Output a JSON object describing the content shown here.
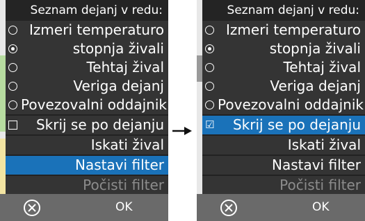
{
  "before": {
    "header": "Seznam dejanj v redu:",
    "items": [
      {
        "label": "Izmeri temperaturo",
        "control": "radio",
        "checked": false
      },
      {
        "label": "stopnja živali",
        "control": "radio",
        "checked": true
      },
      {
        "label": "Tehtaj žival",
        "control": "radio",
        "checked": false
      },
      {
        "label": "Veriga dejanj",
        "control": "radio",
        "checked": false
      },
      {
        "label": "Povezovalni oddajnik",
        "control": "radio",
        "checked": false
      },
      {
        "label": "Skrij se po dejanju",
        "control": "checkbox",
        "checked": false
      },
      {
        "label": "Iskati žival",
        "control": "none"
      },
      {
        "label": "Nastavi filter",
        "control": "none",
        "selected": true
      },
      {
        "label": "Počisti filter",
        "control": "none",
        "disabled": true
      }
    ],
    "footer": {
      "cancel_icon": "circle-x-icon",
      "ok_label": "OK"
    }
  },
  "after": {
    "header": "Seznam dejanj v redu:",
    "items": [
      {
        "label": "Izmeri temperaturo",
        "control": "radio",
        "checked": false
      },
      {
        "label": "stopnja živali",
        "control": "radio",
        "checked": true
      },
      {
        "label": "Tehtaj žival",
        "control": "radio",
        "checked": false
      },
      {
        "label": "Veriga dejanj",
        "control": "radio",
        "checked": false
      },
      {
        "label": "Povezovalni oddajnik",
        "control": "radio",
        "checked": false
      },
      {
        "label": "Skrij se po dejanju",
        "control": "checkbox",
        "checked": true,
        "selected": true
      },
      {
        "label": "Iskati žival",
        "control": "none"
      },
      {
        "label": "Nastavi filter",
        "control": "none"
      },
      {
        "label": "Počisti filter",
        "control": "none",
        "disabled": true
      }
    ],
    "footer": {
      "cancel_icon": "circle-x-icon",
      "ok_label": "OK"
    }
  },
  "arrow_icon": "right-arrow-icon",
  "colors": {
    "selected": "#1a72b9",
    "menu_bg": "#343434",
    "header_bg": "#242424",
    "footer_bg": "#6a6a6a",
    "disabled_text": "#8c8c8c"
  }
}
